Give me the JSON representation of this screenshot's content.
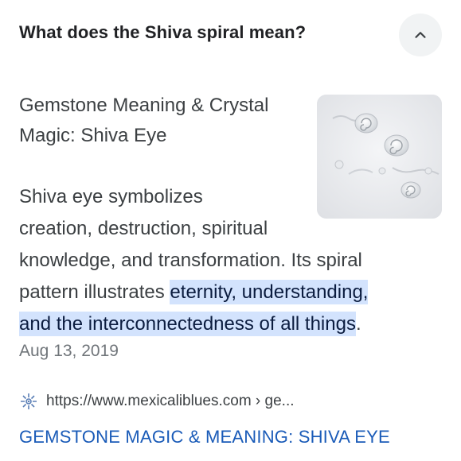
{
  "question": "What does the Shiva spiral mean?",
  "source_title_line1": "Gemstone Meaning & Crystal",
  "source_title_line2": "Magic: Shiva Eye",
  "answer": {
    "line1": "Shiva eye symbolizes",
    "line2": "creation, destruction, spiritual",
    "line3": "knowledge, and transformation. Its spiral",
    "line4_plain": "pattern illustrates ",
    "line4_highlight": "eternity, understanding,",
    "line5_highlight": "and the interconnectedness of all things",
    "line5_tail": "."
  },
  "date": "Aug 13, 2019",
  "source_url": "https://www.mexicaliblues.com › ge...",
  "result_link": "GEMSTONE MAGIC & MEANING: SHIVA EYE",
  "icons": {
    "collapse": "chevron-up-icon",
    "favicon": "site-favicon-icon",
    "thumbnail": "shiva-eye-shells-image"
  },
  "colors": {
    "link": "#1a5bb8",
    "highlight": "#d3e3fd",
    "button_bg": "#f1f3f4"
  }
}
